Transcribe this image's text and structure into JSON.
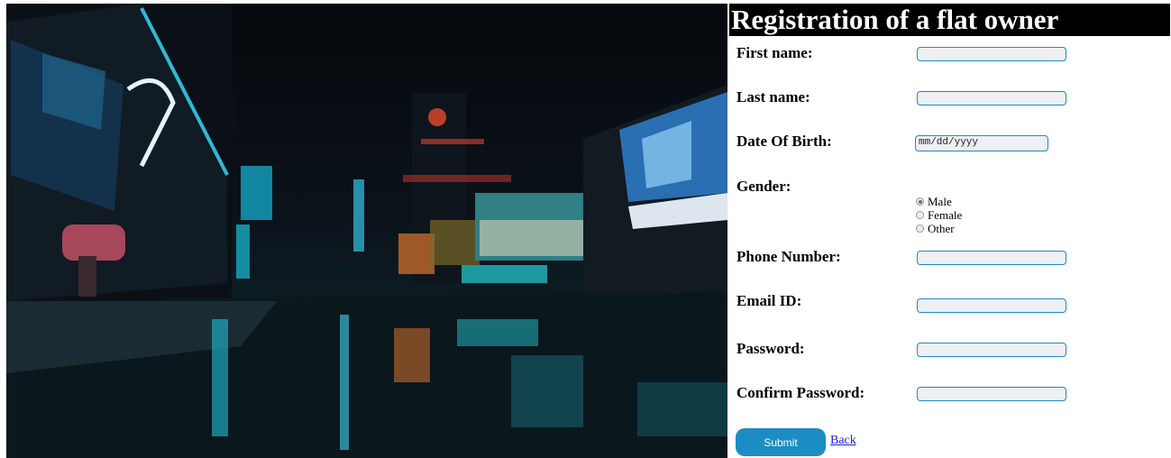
{
  "form": {
    "title": "Registration of a flat owner",
    "fields": [
      {
        "label": "First name:",
        "value": ""
      },
      {
        "label": "Last name:",
        "value": ""
      },
      {
        "label": "Date Of Birth:",
        "placeholder": "mm/dd/yyyy"
      },
      {
        "label": "Gender:"
      },
      {
        "label": "Phone Number:",
        "value": ""
      },
      {
        "label": "Email ID:",
        "value": ""
      },
      {
        "label": "Password:",
        "value": ""
      },
      {
        "label": "Confirm Password:",
        "value": ""
      }
    ],
    "gender_options": [
      "Male",
      "Female",
      "Other"
    ],
    "gender_selected": "Male",
    "submit_label": "Submit",
    "back_label": "Back"
  },
  "colors": {
    "accent": "#1b8dc4",
    "title_bg": "#000000",
    "link": "#1a1aee"
  },
  "icons": [
    "radio-selected-icon",
    "radio-unselected-icon"
  ]
}
